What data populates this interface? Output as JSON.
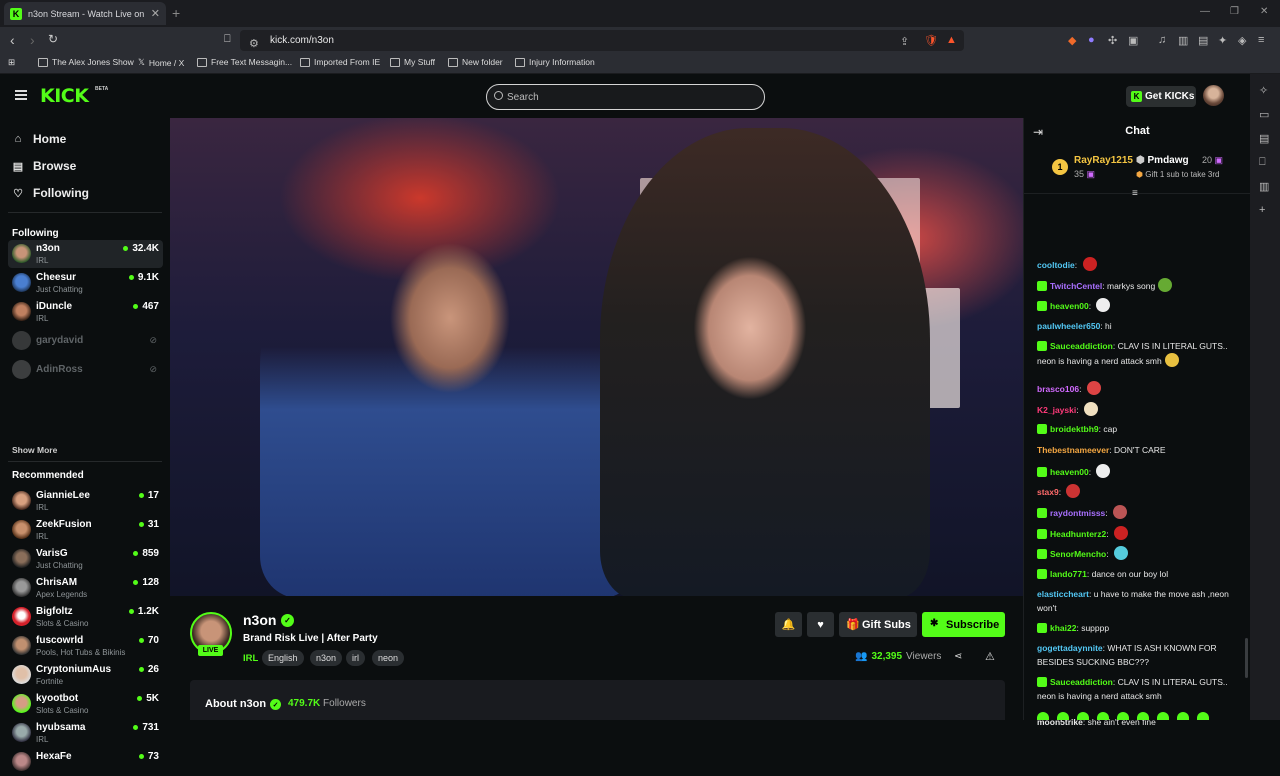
{
  "browser": {
    "tab_title": "n3on Stream - Watch Live on",
    "tab_favicon": "K",
    "url": "kick.com/n3on",
    "bookmarks": [
      {
        "label": "The Alex Jones Show",
        "icon": "page-icon"
      },
      {
        "label": "Home / X",
        "icon": "x-logo-icon"
      },
      {
        "label": "Free Text Messagin...",
        "icon": "page-icon"
      },
      {
        "label": "Imported From IE",
        "icon": "folder-icon"
      },
      {
        "label": "My Stuff",
        "icon": "folder-icon"
      },
      {
        "label": "New folder",
        "icon": "folder-icon"
      },
      {
        "label": "Injury Information",
        "icon": "folder-icon"
      }
    ]
  },
  "header": {
    "logo": "KICK",
    "beta": "BETA",
    "search_placeholder": "Search",
    "get_kicks": "Get KICKs"
  },
  "sidebar": {
    "nav": [
      {
        "label": "Home",
        "icon": "home-icon"
      },
      {
        "label": "Browse",
        "icon": "browse-icon"
      },
      {
        "label": "Following",
        "icon": "heart-icon"
      }
    ],
    "following_heading": "Following",
    "following": [
      {
        "name": "n3on",
        "category": "IRL",
        "viewers": "32.4K",
        "active": true
      },
      {
        "name": "Cheesur",
        "category": "Just Chatting",
        "viewers": "9.1K"
      },
      {
        "name": "iDuncle",
        "category": "IRL",
        "viewers": "467"
      },
      {
        "name": "garydavid",
        "offline": true
      },
      {
        "name": "AdinRoss",
        "offline": true
      }
    ],
    "show_more": "Show More",
    "recommended_heading": "Recommended",
    "recommended": [
      {
        "name": "GiannieLee",
        "category": "IRL",
        "viewers": "17"
      },
      {
        "name": "ZeekFusion",
        "category": "IRL",
        "viewers": "31"
      },
      {
        "name": "VarisG",
        "category": "Just Chatting",
        "viewers": "859"
      },
      {
        "name": "ChrisAM",
        "category": "Apex Legends",
        "viewers": "128"
      },
      {
        "name": "Bigfoltz",
        "category": "Slots & Casino",
        "viewers": "1.2K"
      },
      {
        "name": "fuscowrld",
        "category": "Pools, Hot Tubs & Bikinis",
        "viewers": "70"
      },
      {
        "name": "CryptoniumAus",
        "category": "Fortnite",
        "viewers": "26"
      },
      {
        "name": "kyootbot",
        "category": "Slots & Casino",
        "viewers": "5K"
      },
      {
        "name": "hyubsama",
        "category": "IRL",
        "viewers": "731"
      },
      {
        "name": "HexaFe",
        "category": "",
        "viewers": "73"
      }
    ]
  },
  "stream": {
    "live_badge": "LIVE",
    "streamer": "n3on",
    "title": "Brand Risk Live | After Party",
    "category": "IRL",
    "tags": [
      "English",
      "n3on",
      "irl",
      "neon"
    ],
    "gift_subs": "Gift Subs",
    "subscribe": "Subscribe",
    "viewers": "32,395",
    "viewers_label": "Viewers",
    "about_title": "About n3on",
    "followers": "479.7K",
    "followers_label": "Followers"
  },
  "chat": {
    "title": "Chat",
    "gifter1": {
      "rank": "1",
      "name": "RayRay1215",
      "count": "35"
    },
    "gifter2": {
      "name": "Pmdawg",
      "count": "20",
      "note": "Gift 1 sub to take 3rd"
    },
    "messages": [
      {
        "user": "cooltodie",
        "color": "#53c8f5",
        "text": ""
      },
      {
        "user": "TwitchCentel",
        "color": "#a970ff",
        "text": "markys song"
      },
      {
        "user": "heaven00",
        "color": "#53fc18",
        "text": ""
      },
      {
        "user": "paulwheeler650",
        "color": "#53c8f5",
        "text": "hi"
      },
      {
        "user": "Sauceaddiction",
        "color": "#53fc18",
        "text": "CLAV IS IN LITERAL GUTS.. neon is having a nerd attack smh"
      },
      {
        "user": "brasco106",
        "color": "#d16aff",
        "text": ""
      },
      {
        "user": "K2_jayski",
        "color": "#ff3a7a",
        "text": ""
      },
      {
        "user": "broidektbh9",
        "color": "#53fc18",
        "text": "cap"
      },
      {
        "user": "Thebestnameever",
        "color": "#f4a742",
        "text": "DON'T CARE"
      },
      {
        "user": "heaven00",
        "color": "#53fc18",
        "text": ""
      },
      {
        "user": "stax9",
        "color": "#ff6b6b",
        "text": ""
      },
      {
        "user": "raydontmisss",
        "color": "#a970ff",
        "text": ""
      },
      {
        "user": "Headhunterz2",
        "color": "#53fc18",
        "text": ""
      },
      {
        "user": "SenorMencho",
        "color": "#53fc18",
        "text": ""
      },
      {
        "user": "lando771",
        "color": "#53fc18",
        "text": "dance on our boy lol"
      },
      {
        "user": "elasticcheart",
        "color": "#53c8f5",
        "text": "u have to make the move ash ,neon won't"
      },
      {
        "user": "khai22",
        "color": "#53fc18",
        "text": "supppp"
      },
      {
        "user": "gogettadaynnite",
        "color": "#53c8f5",
        "text": "WHAT IS ASH KNOWN FOR BESIDES SUCKING BBC???"
      },
      {
        "user": "Sauceaddiction",
        "color": "#53fc18",
        "text": "CLAV IS IN LITERAL GUTS.. neon is having a nerd attack smh"
      },
      {
        "user": "moon5trike",
        "color": "#e8e8e8",
        "text": "she ain't even fine"
      }
    ]
  }
}
